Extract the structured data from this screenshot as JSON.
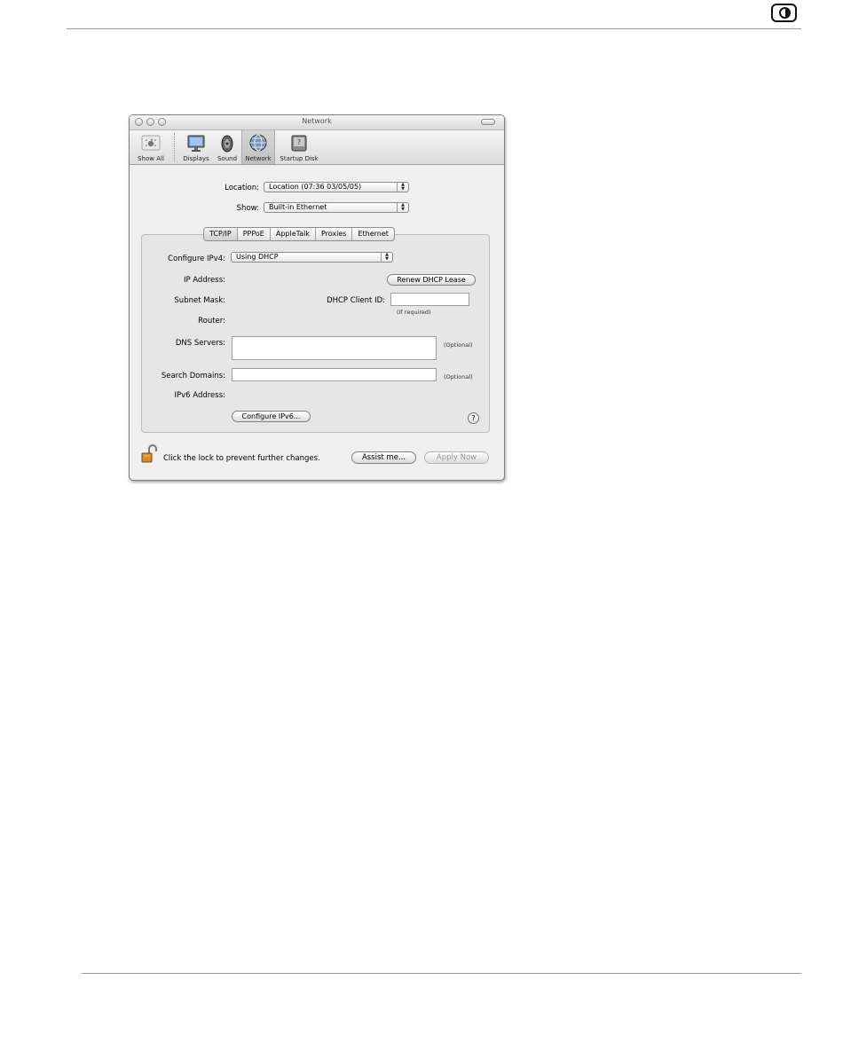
{
  "window": {
    "title": "Network"
  },
  "toolbar": {
    "items": [
      {
        "label": "Show All",
        "icon": "apple-grid-icon"
      },
      {
        "label": "Displays",
        "icon": "display-icon"
      },
      {
        "label": "Sound",
        "icon": "speaker-icon"
      },
      {
        "label": "Network",
        "icon": "network-globe-icon",
        "selected": true
      },
      {
        "label": "Startup Disk",
        "icon": "startup-disk-icon"
      }
    ]
  },
  "form": {
    "location_label": "Location:",
    "location_value": "Location (07:36 03/05/05)",
    "show_label": "Show:",
    "show_value": "Built-in Ethernet"
  },
  "tabs": [
    {
      "label": "TCP/IP",
      "active": true
    },
    {
      "label": "PPPoE",
      "active": false
    },
    {
      "label": "AppleTalk",
      "active": false
    },
    {
      "label": "Proxies",
      "active": false
    },
    {
      "label": "Ethernet",
      "active": false
    }
  ],
  "tcpip": {
    "configure_label": "Configure IPv4:",
    "configure_value": "Using DHCP",
    "ip_label": "IP Address:",
    "renew_button": "Renew DHCP Lease",
    "subnet_label": "Subnet Mask:",
    "client_id_label": "DHCP Client ID:",
    "client_id_value": "",
    "if_required": "(If required)",
    "router_label": "Router:",
    "dns_label": "DNS Servers:",
    "dns_value": "",
    "dns_optional": "(Optional)",
    "search_label": "Search Domains:",
    "search_value": "",
    "search_optional": "(Optional)",
    "ipv6_label": "IPv6 Address:",
    "configure_ipv6_button": "Configure IPv6...",
    "help_label": "?"
  },
  "footer": {
    "lock_text": "Click the lock to prevent further changes.",
    "assist_button": "Assist me...",
    "apply_button": "Apply Now"
  }
}
